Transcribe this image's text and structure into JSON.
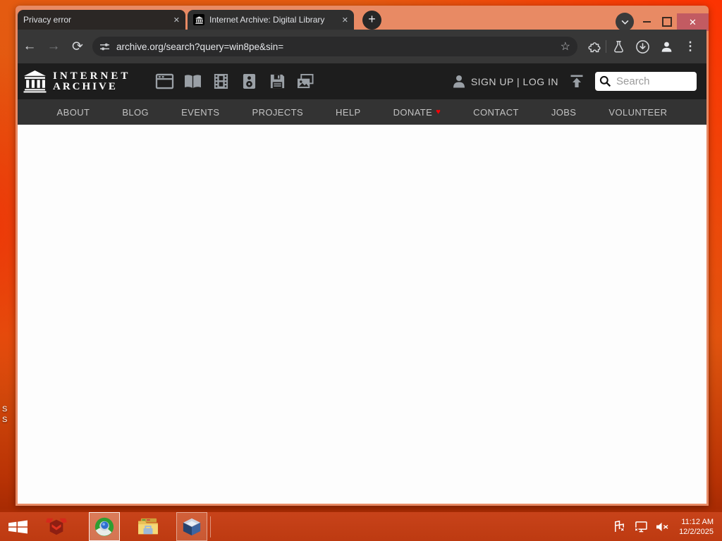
{
  "browser": {
    "tabs": {
      "privacy": {
        "title": "Privacy error"
      },
      "archive": {
        "title": "Internet Archive: Digital Library"
      }
    },
    "address": {
      "url": "archive.org/search?query=win8pe&sin="
    }
  },
  "ia": {
    "logo": {
      "line1": "INTERNET",
      "line2": "ARCHIVE"
    },
    "auth_text": "SIGN UP | LOG IN",
    "search_placeholder": "Search",
    "nav_items": [
      "ABOUT",
      "BLOG",
      "EVENTS",
      "PROJECTS",
      "HELP",
      "DONATE",
      "CONTACT",
      "JOBS",
      "VOLUNTEER"
    ]
  },
  "tray": {
    "time": "11:12 AM",
    "date": "12/2/2025"
  },
  "desktop": {
    "fragments": [
      "S",
      "S"
    ]
  },
  "icons": {
    "close": "✕",
    "plus": "+",
    "back": "←",
    "forward": "→",
    "reload": "⟳",
    "star": "☆",
    "menu": "⋮",
    "heart": "♥"
  },
  "colors": {
    "window_frame": "#e88a64",
    "close_button": "#c25b62",
    "toolbar": "#373737",
    "ia_header": "#1d1d1d",
    "ia_nav": "#333333",
    "taskbar": "#c8431a",
    "heart": "#fb0005"
  }
}
